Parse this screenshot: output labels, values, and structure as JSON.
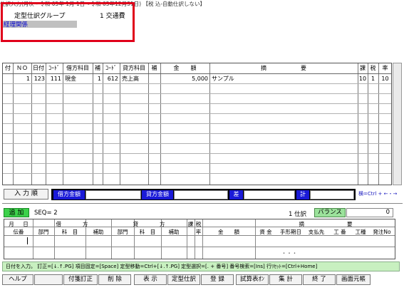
{
  "window": {
    "title": "仕訳入力(月次 - 令和 05年 1月 1日～令和 05年12月31日) 【税 込-自動仕訳しない】"
  },
  "header": {
    "group_label": "定型仕訳グループ",
    "group_value": "1 交通費",
    "category": "経理関係"
  },
  "grid": {
    "columns": [
      "付",
      "ＮＯ",
      "日付",
      "ｺｰﾄﾞ",
      "借方科目",
      "補",
      "ｺｰﾄﾞ",
      "貸方科目",
      "補",
      "金　　額",
      "摘　　　　　　要",
      "課",
      "税",
      "率"
    ],
    "rows": [
      {
        "fu": "",
        "no": "1",
        "date": "123",
        "debit_code": "111",
        "debit_account": "現金",
        "debit_sub": "1",
        "credit_code": "612",
        "credit_account": "売上高",
        "credit_sub": "",
        "amount": "5,000",
        "memo": "サンプル",
        "ka": "10",
        "zei": "1",
        "rate": "10"
      }
    ]
  },
  "input_row": {
    "mode_label": "入 力 順",
    "debit_total_label": "借方金額",
    "credit_total_label": "貸方金額",
    "diff_label": "差",
    "total_label": "計",
    "hint": "横=Ctrl + ←・→"
  },
  "entry": {
    "add_label": "追 加",
    "seq": "SEQ= 2",
    "shiwake": "1 仕訳",
    "balance_label": "バランス",
    "balance_value": "0",
    "headers_top": [
      "月",
      "日",
      "借　　　　方",
      "貸　　　　方",
      "課",
      "税",
      "摘　　　　　　　　要"
    ],
    "headers_bottom": [
      "伝番",
      "部門",
      "科　目",
      "補助",
      "部門",
      "科　目",
      "補助",
      "non",
      "率",
      "金　　額",
      "資 金",
      "手形期日",
      "支払先",
      "工 番",
      "工種",
      "発注No"
    ],
    "denban": "1",
    "dots": "・・・"
  },
  "statusbar": {
    "text": "日付を入力。 訂正=[↓.↑.PG] 項目固定=[Space] 定型移動=Ctrl+[↓.↑.PG] 定型選択=[. + 番号] 番号検索=[Ins] 行ﾘｾｯﾄ=[Ctrl+Home]"
  },
  "function_keys": [
    "ヘルプ",
    "",
    "付箋訂正",
    "削 除",
    "表 示",
    "定型仕訳",
    "登 録",
    "試算表ｵﾝ",
    "集 計",
    "終 了",
    "画面元帳"
  ],
  "colors": {
    "annotation_red": "#e0001a",
    "blue_button": "#1a1ad8",
    "add_green": "#3cd14a",
    "balance_green": "#9be29b",
    "status_green": "#c8f0c0",
    "category_blue": "#0000d0"
  }
}
